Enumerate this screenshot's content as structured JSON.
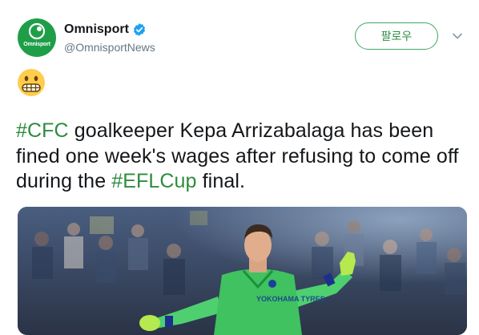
{
  "account": {
    "display_name": "Omnisport",
    "handle": "@OmnisportNews",
    "avatar_text": "Omnisport",
    "verified": true
  },
  "follow_button": {
    "label": "팔로우"
  },
  "emoji": {
    "name": "grimacing-face"
  },
  "tweet": {
    "segments": [
      {
        "text": "#CFC",
        "hashtag": true
      },
      {
        "text": " goalkeeper Kepa Arrizabalaga has been fined one week's wages after refusing to come off during the ",
        "hashtag": false
      },
      {
        "text": "#EFLCup",
        "hashtag": true
      },
      {
        "text": " final.",
        "hashtag": false
      }
    ]
  },
  "media": {
    "jersey_text": "YOKOHAMA TYRES"
  },
  "colors": {
    "accent_green": "#2e8b3e",
    "avatar_green": "#1f9e48",
    "verified_blue": "#1da1f2",
    "text": "#14171a",
    "muted": "#657786"
  }
}
